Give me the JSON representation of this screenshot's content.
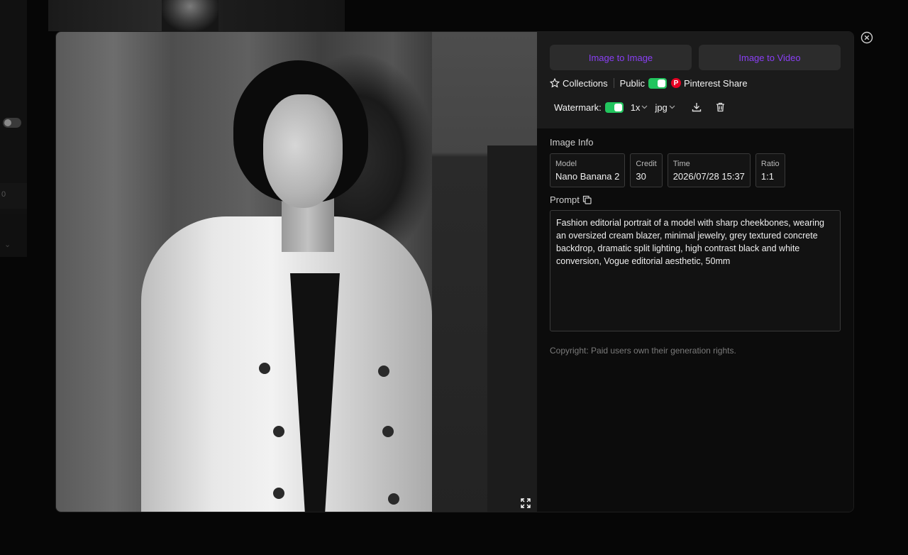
{
  "background": {
    "list_fragment_text": "0",
    "chevron": "⌄"
  },
  "actions": {
    "image_to_image": "Image to Image",
    "image_to_video": "Image to Video"
  },
  "meta": {
    "collections_label": "Collections",
    "public_label": "Public",
    "public_on": true,
    "pinterest_label": "Pinterest Share"
  },
  "download": {
    "watermark_label": "Watermark:",
    "watermark_on": true,
    "scale_value": "1x",
    "format_value": "jpg"
  },
  "image_info": {
    "title": "Image Info",
    "cards": [
      {
        "label": "Model",
        "value": "Nano Banana 2"
      },
      {
        "label": "Credit",
        "value": "30"
      },
      {
        "label": "Time",
        "value": "2026/07/28 15:37"
      },
      {
        "label": "Ratio",
        "value": "1:1"
      }
    ]
  },
  "prompt": {
    "title": "Prompt",
    "text": "Fashion editorial portrait of a model with sharp cheekbones, wearing an oversized cream blazer, minimal jewelry, grey textured concrete backdrop, dramatic split lighting, high contrast black and white conversion, Vogue editorial aesthetic, 50mm"
  },
  "copyright": "Copyright: Paid users own their generation rights.",
  "colors": {
    "accent": "#8a3ff5",
    "toggle_on": "#22c55e",
    "pinterest": "#e60023"
  },
  "icons": {
    "collections": "star-icon",
    "download": "download-icon",
    "delete": "trash-icon",
    "copy": "copy-icon",
    "expand": "expand-icon",
    "close": "close-circle-icon"
  }
}
